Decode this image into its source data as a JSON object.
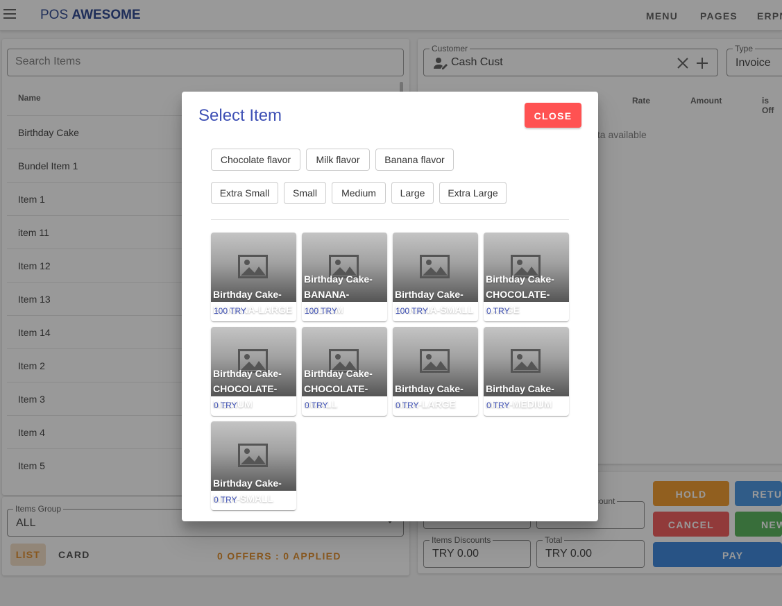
{
  "app": {
    "title_prefix": "POS ",
    "title_bold": "AWESOME"
  },
  "topnav": [
    "MENU",
    "PAGES",
    "ERPN"
  ],
  "items_panel": {
    "search_placeholder": "Search Items",
    "column_name": "Name",
    "rows": [
      "Birthday Cake",
      "Bundel Item 1",
      "Item 1",
      "item 11",
      "Item 12",
      "Item 13",
      "Item 14",
      "Item 2",
      "Item 3",
      "Item 4",
      "Item 5"
    ],
    "items_group_label": "Items Group",
    "items_group_value": "ALL",
    "list_label": "LIST",
    "card_label": "CARD",
    "offers_text": "0 OFFERS : 0 APPLIED"
  },
  "invoice_panel": {
    "customer_label": "Customer",
    "customer_value": "Cash Cust",
    "type_label": "Type",
    "type_value": "Invoice",
    "columns": [
      "Rate",
      "Amount",
      "is Off"
    ],
    "no_data": "lata available",
    "discount_label_partial": "count",
    "items_discounts_label": "Items Discounts",
    "items_discounts_value": "TRY 0.00",
    "total_label": "Total",
    "total_value": "TRY 0.00",
    "buttons": {
      "hold": "HOLD",
      "return": "RETU",
      "cancel": "CANCEL",
      "new": "NEW",
      "pay": "PAY"
    }
  },
  "dialog": {
    "title": "Select Item",
    "close_label": "CLOSE",
    "flavors": [
      "Chocolate flavor",
      "Milk flavor",
      "Banana flavor"
    ],
    "sizes": [
      "Extra Small",
      "Small",
      "Medium",
      "Large",
      "Extra Large"
    ],
    "items": [
      {
        "lines": [
          "Birthday Cake-",
          "BANANA-LARGE"
        ],
        "price": "100 TRY"
      },
      {
        "lines": [
          "Birthday Cake-",
          "BANANA-",
          "MEDIUM"
        ],
        "price": "100 TRY"
      },
      {
        "lines": [
          "Birthday Cake-",
          "BANANA-SMALL"
        ],
        "price": "100 TRY"
      },
      {
        "lines": [
          "Birthday Cake-",
          "CHOCOLATE-",
          "LARGE"
        ],
        "price": "0 TRY"
      },
      {
        "lines": [
          "Birthday Cake-",
          "CHOCOLATE-",
          "MEDIUM"
        ],
        "price": "0 TRY"
      },
      {
        "lines": [
          "Birthday Cake-",
          "CHOCOLATE-",
          "SMALL"
        ],
        "price": "0 TRY"
      },
      {
        "lines": [
          "Birthday Cake-",
          "MILK-LARGE"
        ],
        "price": "0 TRY"
      },
      {
        "lines": [
          "Birthday Cake-",
          "MILK-MEDIUM"
        ],
        "price": "0 TRY"
      },
      {
        "lines": [
          "Birthday Cake-",
          "MILK-SMALL"
        ],
        "price": "0 TRY"
      }
    ]
  },
  "colors": {
    "brand": "#1e3a8a",
    "accent": "#3f51b5",
    "close": "#ff5252",
    "hold": "#f0941f",
    "cancel": "#f05050",
    "return": "#3d8fe0",
    "new": "#4caf50",
    "pay": "#2f7fdb",
    "offers": "#e0861a"
  }
}
